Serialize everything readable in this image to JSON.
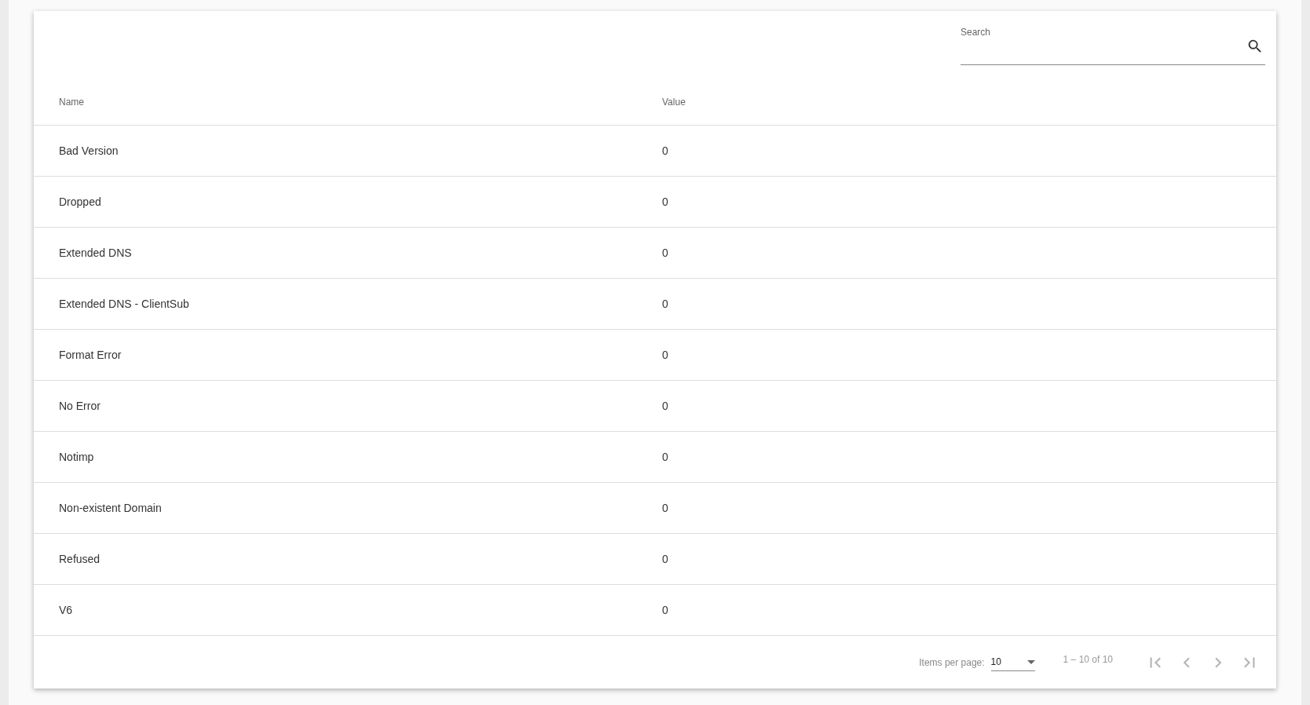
{
  "search": {
    "label": "Search"
  },
  "table": {
    "columns": [
      "Name",
      "Value"
    ],
    "rows": [
      {
        "name": "Bad Version",
        "value": "0"
      },
      {
        "name": "Dropped",
        "value": "0"
      },
      {
        "name": "Extended DNS",
        "value": "0"
      },
      {
        "name": "Extended DNS - ClientSub",
        "value": "0"
      },
      {
        "name": "Format Error",
        "value": "0"
      },
      {
        "name": "No Error",
        "value": "0"
      },
      {
        "name": "Notimp",
        "value": "0"
      },
      {
        "name": "Non-existent Domain",
        "value": "0"
      },
      {
        "name": "Refused",
        "value": "0"
      },
      {
        "name": "V6",
        "value": "0"
      }
    ]
  },
  "paginator": {
    "items_per_page_label": "Items per page:",
    "page_size": "10",
    "range": "1 – 10 of 10",
    "buttons": [
      {
        "kind": "first",
        "disabled": true
      },
      {
        "kind": "previous",
        "disabled": true
      },
      {
        "kind": "next",
        "disabled": true
      },
      {
        "kind": "last",
        "disabled": true
      }
    ]
  }
}
